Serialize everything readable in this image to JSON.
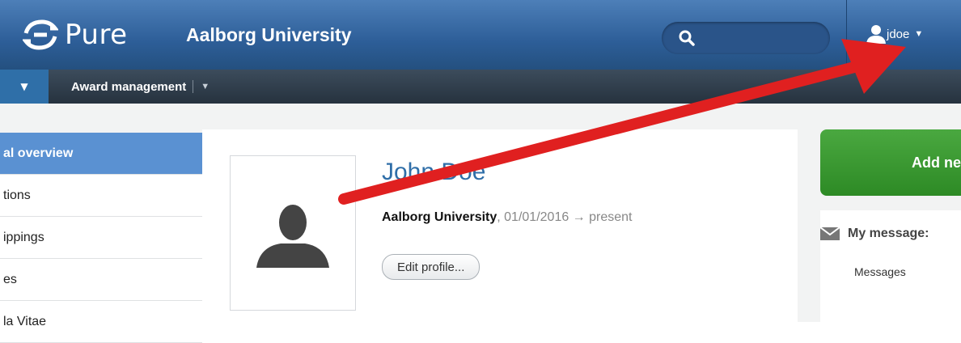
{
  "header": {
    "app_name": "Pure",
    "organization": "Aalborg University",
    "search_placeholder": "",
    "user": "jdoe"
  },
  "navbar": {
    "items": [
      {
        "label": "Award management"
      }
    ]
  },
  "sidebar": {
    "items": [
      {
        "label": "al overview",
        "active": true
      },
      {
        "label": "tions"
      },
      {
        "label": "ippings"
      },
      {
        "label": "es"
      },
      {
        "label": "la Vitae"
      }
    ]
  },
  "profile": {
    "name": "John Doe",
    "affiliation": "Aalborg University",
    "period": ", 01/01/2016 → present",
    "edit_label": "Edit profile..."
  },
  "actions": {
    "add_new_label": "Add ne"
  },
  "messages": {
    "title": "My message:",
    "link": "Messages"
  },
  "colors": {
    "header": "#2d5e98",
    "accent": "#5a91d2",
    "green": "#2d8a25",
    "annotation_arrow": "#e02020"
  },
  "icons": {
    "search": "search-icon",
    "user": "user-icon",
    "mail": "mail-icon",
    "avatar": "avatar-silhouette-icon"
  }
}
